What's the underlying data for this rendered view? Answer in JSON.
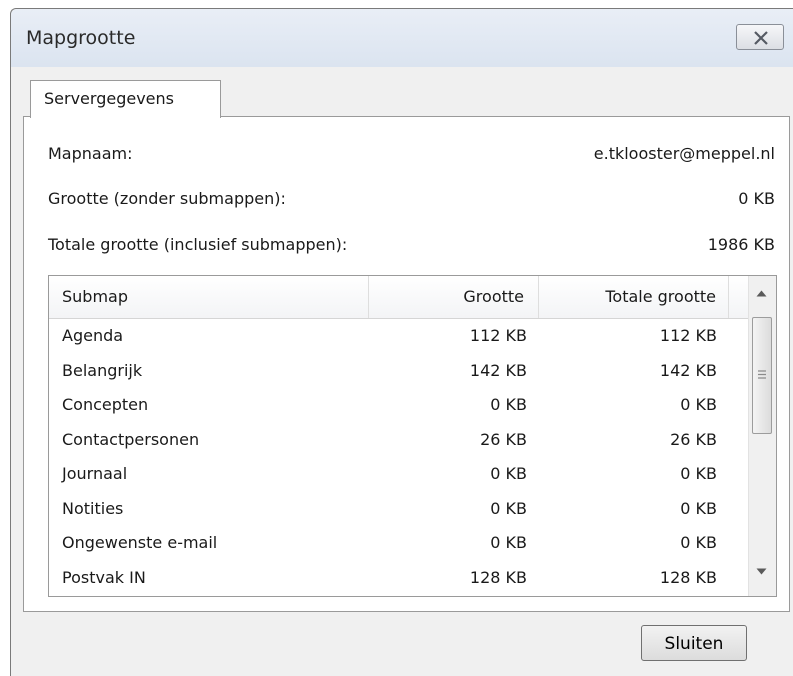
{
  "window": {
    "title": "Mapgrootte"
  },
  "tab": {
    "label": "Servergegevens"
  },
  "info": {
    "folder_name_label": "Mapnaam:",
    "folder_name_value": "e.tklooster@meppel.nl",
    "size_label": "Grootte (zonder submappen):",
    "size_value": "0 KB",
    "total_label": "Totale grootte (inclusief submappen):",
    "total_value": "1986 KB"
  },
  "table": {
    "headers": {
      "submap": "Submap",
      "grootte": "Grootte",
      "totaal": "Totale grootte"
    },
    "rows": [
      {
        "name": "Agenda",
        "size": "112 KB",
        "total": "112 KB"
      },
      {
        "name": "Belangrijk",
        "size": "142 KB",
        "total": "142 KB"
      },
      {
        "name": "Concepten",
        "size": "0 KB",
        "total": "0 KB"
      },
      {
        "name": "Contactpersonen",
        "size": "26 KB",
        "total": "26 KB"
      },
      {
        "name": "Journaal",
        "size": "0 KB",
        "total": "0 KB"
      },
      {
        "name": "Notities",
        "size": "0 KB",
        "total": "0 KB"
      },
      {
        "name": "Ongewenste e-mail",
        "size": "0 KB",
        "total": "0 KB"
      },
      {
        "name": "Postvak IN",
        "size": "128 KB",
        "total": "128 KB"
      }
    ]
  },
  "buttons": {
    "close_label": "Sluiten"
  },
  "icons": {
    "close": "close-icon",
    "scroll_up": "scroll-up-arrow-icon",
    "scroll_down": "scroll-down-arrow-icon",
    "grip": "scroll-grip-icon"
  }
}
